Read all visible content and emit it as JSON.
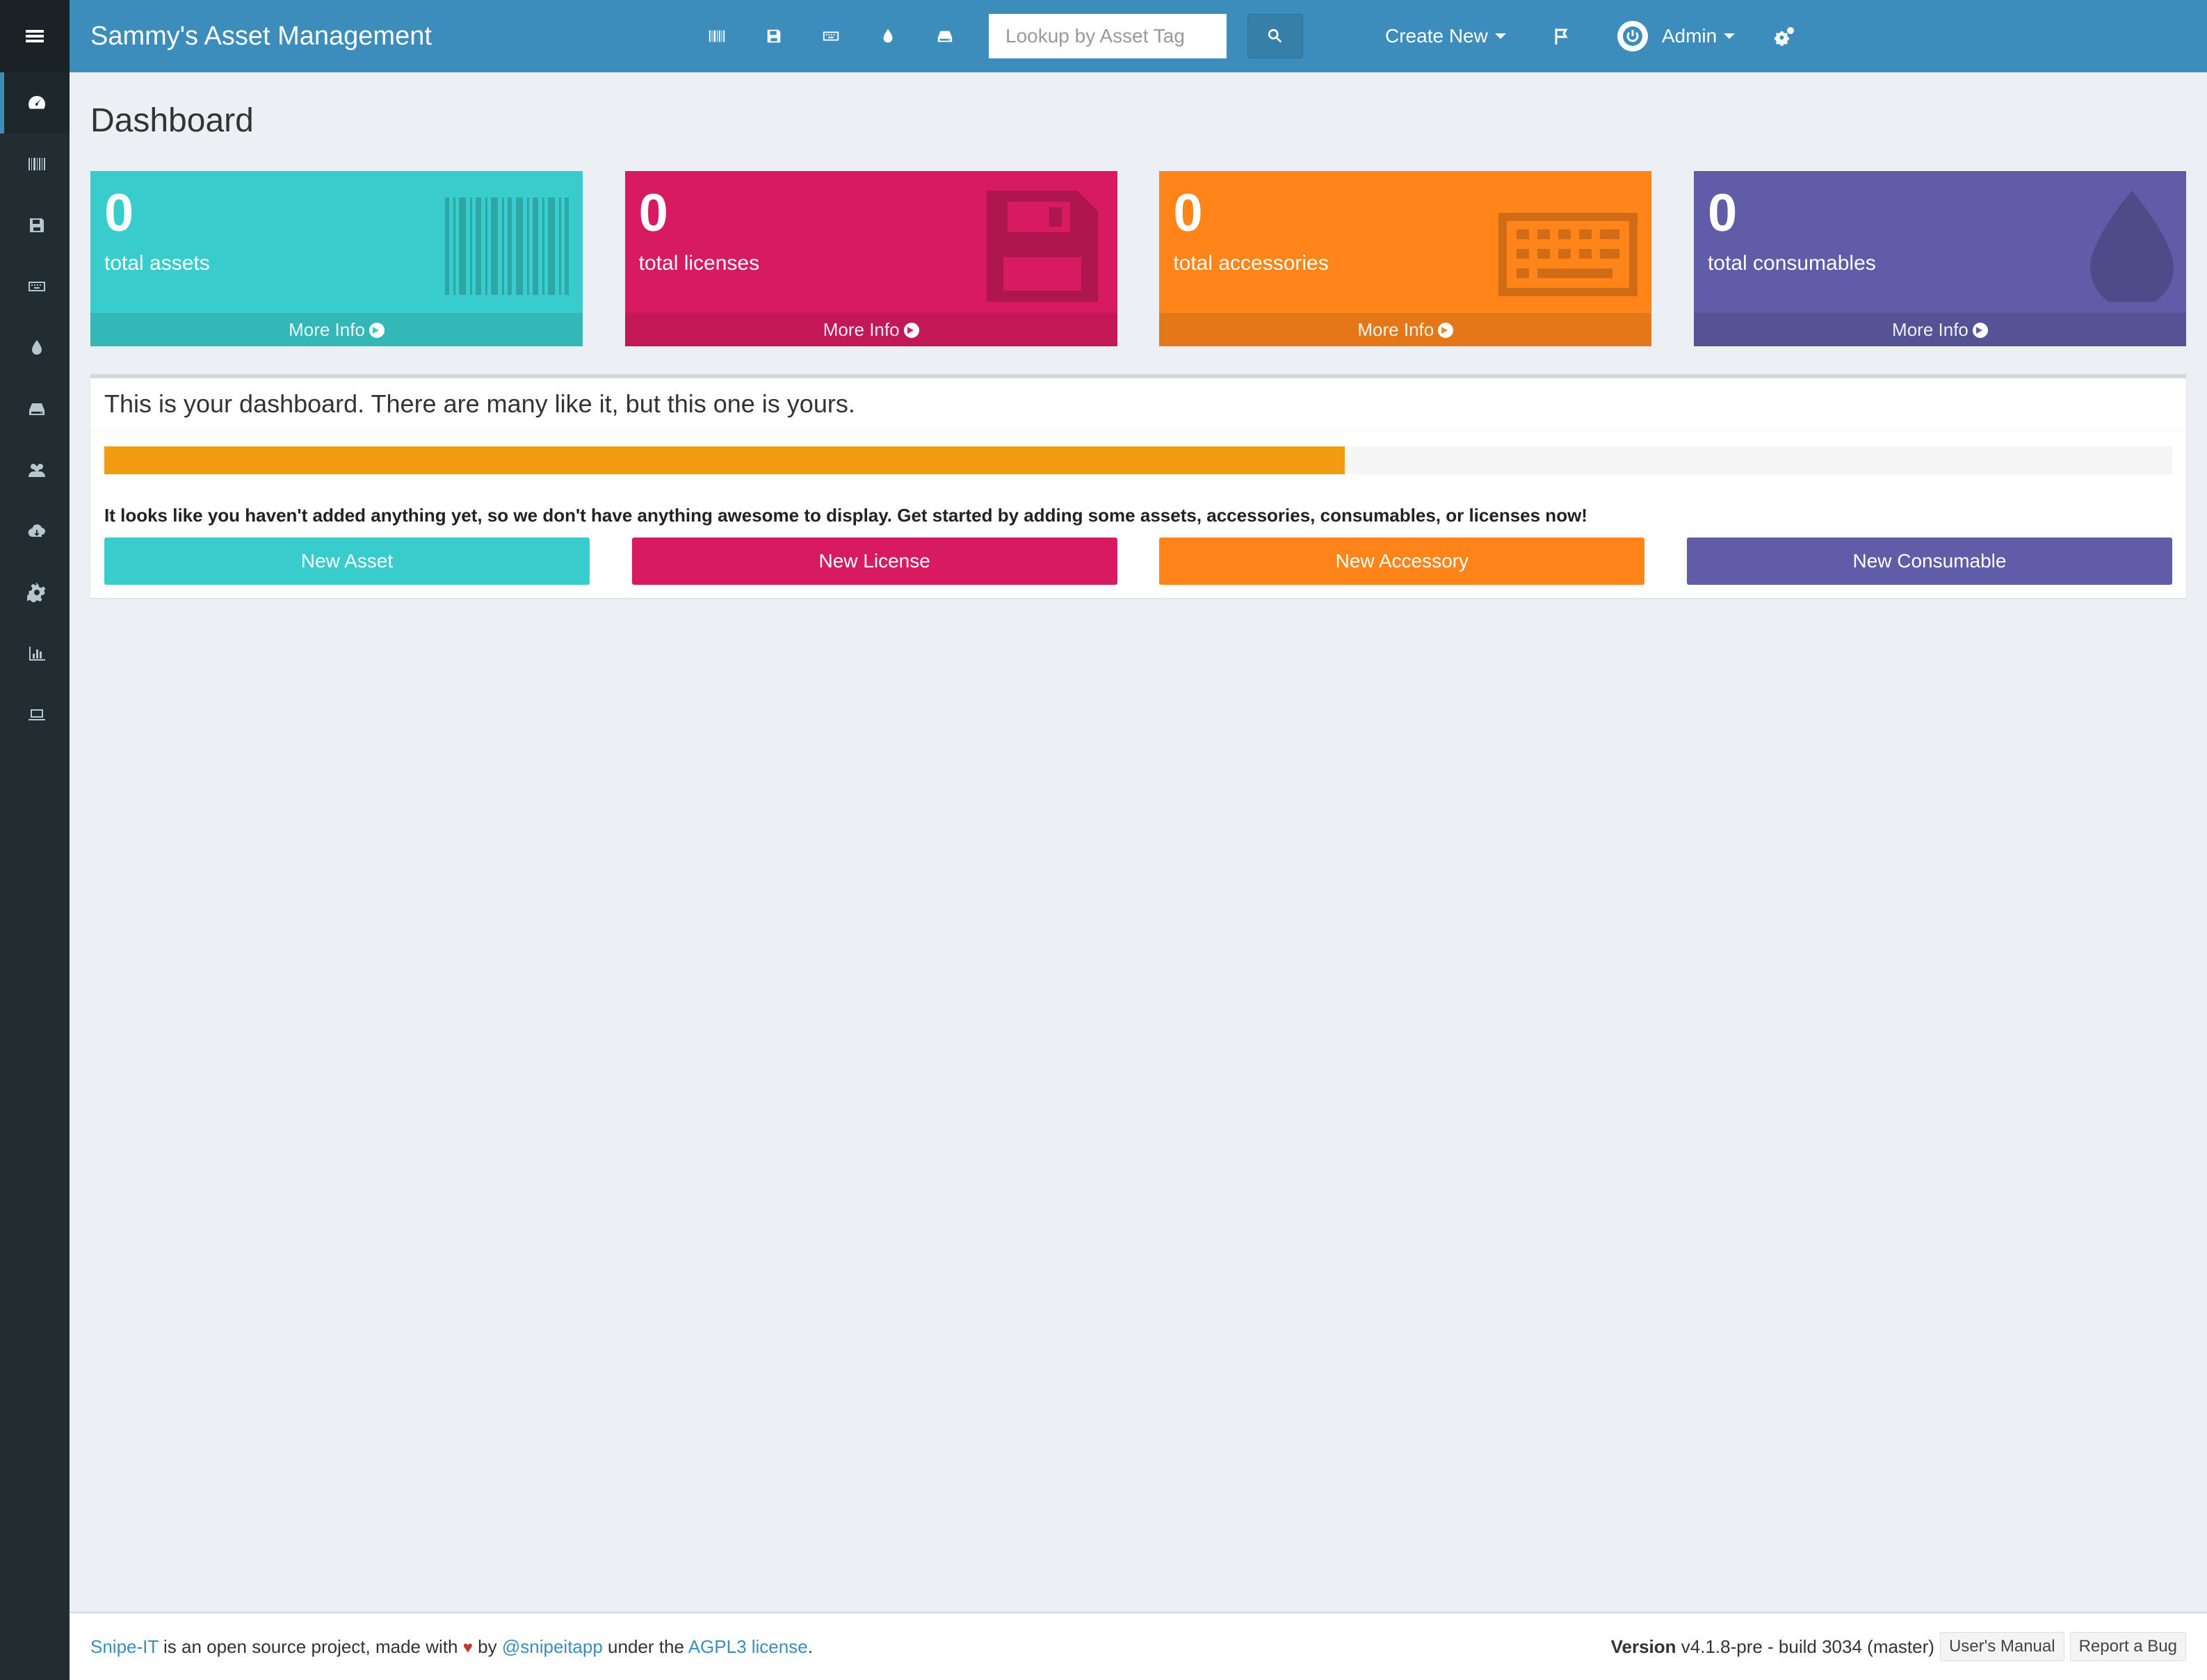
{
  "colors": {
    "header": "#3c8dbc",
    "sidebar": "#222d32",
    "teal": "#39cccc",
    "pink": "#d81b60",
    "orange": "#ff851b",
    "purple": "#605ca8",
    "progress": "#f39c12"
  },
  "sidebar": {
    "items": [
      {
        "icon": "dashboard-icon"
      },
      {
        "icon": "barcode-icon"
      },
      {
        "icon": "floppy-icon"
      },
      {
        "icon": "keyboard-icon"
      },
      {
        "icon": "tint-icon"
      },
      {
        "icon": "hdd-icon"
      },
      {
        "icon": "users-icon"
      },
      {
        "icon": "cloud-download-icon"
      },
      {
        "icon": "gear-icon"
      },
      {
        "icon": "bar-chart-icon"
      },
      {
        "icon": "laptop-icon"
      }
    ]
  },
  "header": {
    "brand": "Sammy's Asset Management",
    "search_placeholder": "Lookup by Asset Tag",
    "create_new": "Create New",
    "user": "Admin"
  },
  "page_title": "Dashboard",
  "stats": [
    {
      "count": "0",
      "label": "total assets",
      "more": "More Info",
      "color": "#39cccc",
      "icon": "barcode-icon"
    },
    {
      "count": "0",
      "label": "total licenses",
      "more": "More Info",
      "color": "#d81b60",
      "icon": "floppy-icon"
    },
    {
      "count": "0",
      "label": "total accessories",
      "more": "More Info",
      "color": "#ff851b",
      "icon": "keyboard-icon"
    },
    {
      "count": "0",
      "label": "total consumables",
      "more": "More Info",
      "color": "#605ca8",
      "icon": "tint-icon"
    }
  ],
  "panel": {
    "title": "This is your dashboard. There are many like it, but this one is yours.",
    "progress": 0.6,
    "message": "It looks like you haven't added anything yet, so we don't have anything awesome to display. Get started by adding some assets, accessories, consumables, or licenses now!",
    "buttons": [
      {
        "label": "New Asset",
        "color": "#39cccc"
      },
      {
        "label": "New License",
        "color": "#d81b60"
      },
      {
        "label": "New Accessory",
        "color": "#ff851b"
      },
      {
        "label": "New Consumable",
        "color": "#605ca8"
      }
    ]
  },
  "footer": {
    "project": "Snipe-IT",
    "text1": " is an open source project, made with ",
    "heart": "♥",
    "text2": " by ",
    "handle": "@snipeitapp",
    "text3": " under the ",
    "license": "AGPL3 license",
    "text4": ".",
    "version_label": "Version",
    "version": "v4.1.8-pre - build 3034 (master)",
    "manual": "User's Manual",
    "bug": "Report a Bug"
  }
}
